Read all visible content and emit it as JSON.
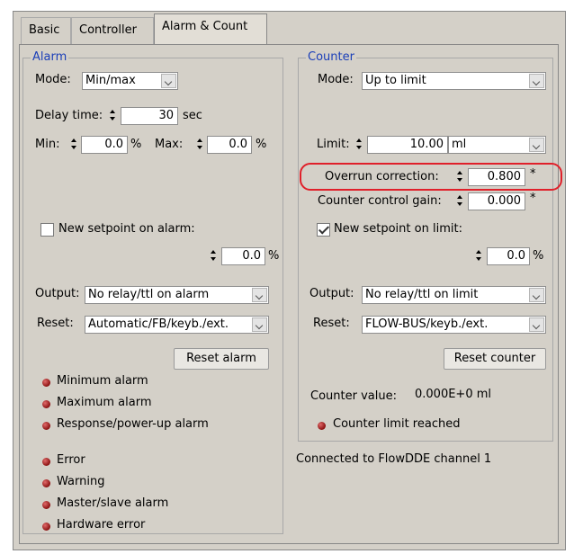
{
  "tabs": [
    "Basic",
    "Controller",
    "Alarm & Count"
  ],
  "alarm": {
    "title": "Alarm",
    "mode_label": "Mode:",
    "mode_value": "Min/max",
    "delay_label": "Delay time:",
    "delay_value": "30",
    "delay_unit": "sec",
    "min_label": "Min:",
    "min_value": "0.0",
    "min_unit": "%",
    "max_label": "Max:",
    "max_value": "0.0",
    "max_unit": "%",
    "new_setpoint_label": "New setpoint on alarm:",
    "new_setpoint_checked": false,
    "setpoint_value": "0.0",
    "setpoint_unit": "%",
    "output_label": "Output:",
    "output_value": "No relay/ttl on alarm",
    "reset_label": "Reset:",
    "reset_value": "Automatic/FB/keyb./ext.",
    "reset_button": "Reset alarm",
    "indicators_a": [
      "Minimum alarm",
      "Maximum alarm",
      "Response/power-up alarm"
    ],
    "indicators_b": [
      "Error",
      "Warning",
      "Master/slave alarm",
      "Hardware error"
    ]
  },
  "counter": {
    "title": "Counter",
    "mode_label": "Mode:",
    "mode_value": "Up to limit",
    "limit_label": "Limit:",
    "limit_value": "10.00",
    "limit_unit": "ml",
    "overrun_label": "Overrun correction:",
    "overrun_value": "0.800",
    "overrun_mark": "*",
    "gain_label": "Counter control gain:",
    "gain_value": "0.000",
    "gain_mark": "*",
    "new_setpoint_label": "New setpoint on limit:",
    "new_setpoint_checked": true,
    "setpoint_value": "0.0",
    "setpoint_unit": "%",
    "output_label": "Output:",
    "output_value": "No relay/ttl on limit",
    "reset_label": "Reset:",
    "reset_value": "FLOW-BUS/keyb./ext.",
    "reset_button": "Reset counter",
    "value_label": "Counter value:",
    "value": "0.000E+0 ml",
    "limit_reached_label": "Counter limit reached"
  },
  "status": "Connected to FlowDDE channel 1",
  "colors": {
    "group_title": "#1b3fb8",
    "highlight": "#e0202a",
    "led": "#8a1010"
  }
}
